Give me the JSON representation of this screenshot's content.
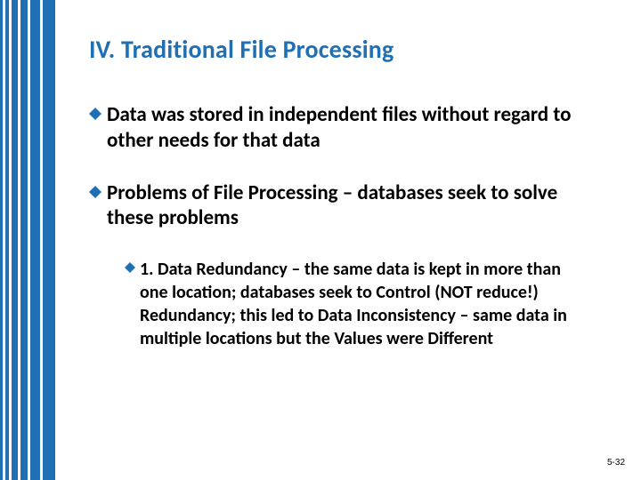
{
  "colors": {
    "accent": "#1f6fb4"
  },
  "title": "IV. Traditional File Processing",
  "bullets": [
    {
      "text": "Data was stored in independent files without regard to other needs for that data"
    },
    {
      "text": "Problems of File Processing – databases seek to solve these problems"
    }
  ],
  "sub_bullet": {
    "text": "1. Data Redundancy – the same data is kept in more than one location; databases seek to Control (NOT reduce!) Redundancy; this led to Data Inconsistency – same data in multiple locations but the Values were Different"
  },
  "page_number": "5-32"
}
